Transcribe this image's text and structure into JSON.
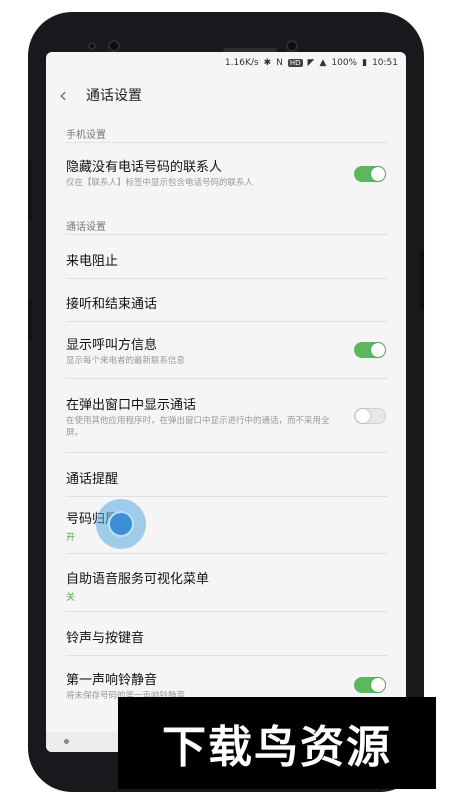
{
  "status_bar": {
    "speed": "1.16K/s",
    "hd_badge": "HD",
    "battery": "100%",
    "time": "10:51"
  },
  "header": {
    "back_icon": "chevron-left-icon",
    "title": "通话设置"
  },
  "sections": {
    "phone": "手机设置",
    "call": "通话设置"
  },
  "rows": {
    "hide_contacts": {
      "title": "隐藏没有电话号码的联系人",
      "sub": "仅在【联系人】标签中显示包含电话号码的联系人",
      "toggle": "on"
    },
    "block": {
      "title": "来电阻止"
    },
    "answer_end": {
      "title": "接听和结束通话"
    },
    "caller_info": {
      "title": "显示呼叫方信息",
      "sub": "显示每个来电者的最新联系信息",
      "toggle": "on"
    },
    "popup": {
      "title": "在弹出窗口中显示通话",
      "sub": "在使用其他应用程序时，在弹出窗口中显示进行中的通话，而不采用全屏。",
      "toggle": "off"
    },
    "alerts": {
      "title": "通话提醒"
    },
    "location": {
      "title": "号码归属地",
      "value": "开"
    },
    "ivr": {
      "title": "自助语音服务可视化菜单",
      "value": "关"
    },
    "ringtone": {
      "title": "铃声与按键音"
    },
    "mute_first": {
      "title": "第一声响铃静音",
      "sub": "将未保存号码的第一声响铃静音",
      "toggle": "on"
    }
  },
  "watermark": "下载鸟资源",
  "colors": {
    "accent": "#5cb85c",
    "value_green": "#4aa64a",
    "touch": "#3c8fd6"
  }
}
